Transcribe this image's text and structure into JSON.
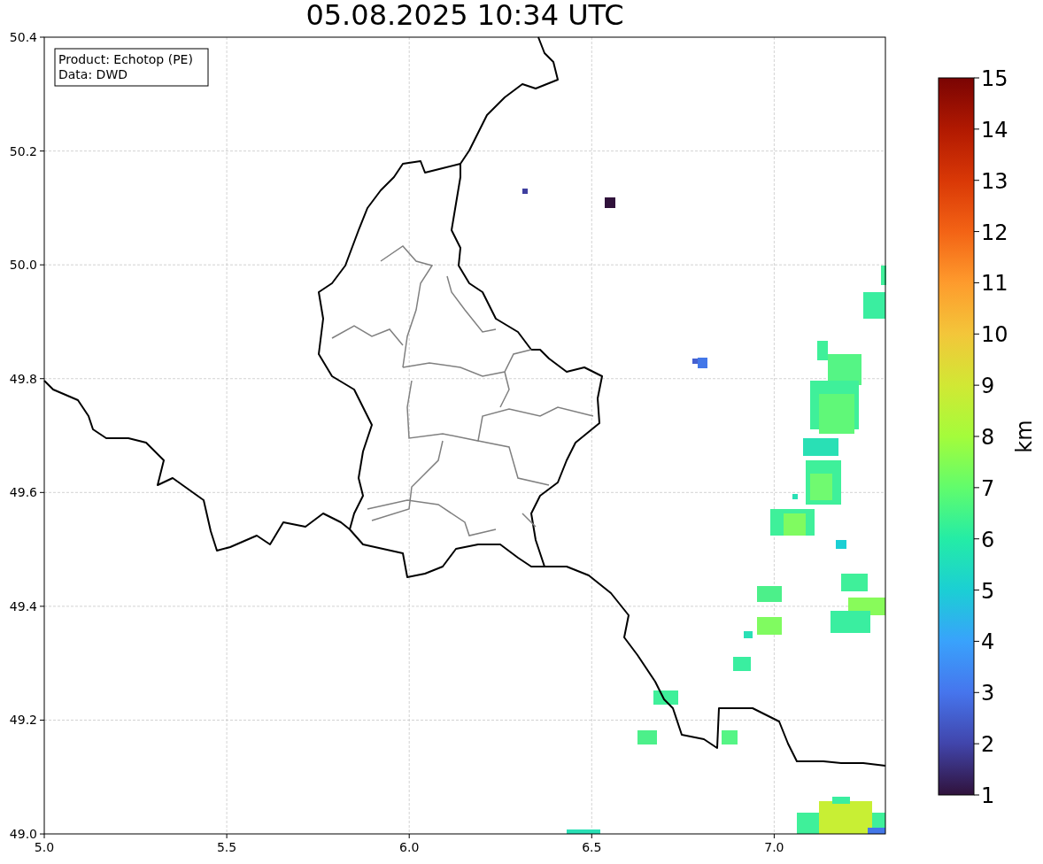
{
  "title": "05.08.2025 10:34 UTC",
  "info_box": [
    "Product: Echotop (PE)",
    "Data: DWD"
  ],
  "map": {
    "xticks": [
      "5.0",
      "5.5",
      "6.0",
      "6.5",
      "7.0"
    ],
    "yticks": [
      "50.4",
      "50.2",
      "50.0",
      "49.8",
      "49.6",
      "49.4",
      "49.2",
      "49.0"
    ]
  },
  "colorbar": {
    "ticks": [
      "15",
      "14",
      "13",
      "12",
      "11",
      "10",
      "9",
      "8",
      "7",
      "6",
      "5",
      "4",
      "3",
      "2",
      "1"
    ],
    "label": "km"
  }
}
